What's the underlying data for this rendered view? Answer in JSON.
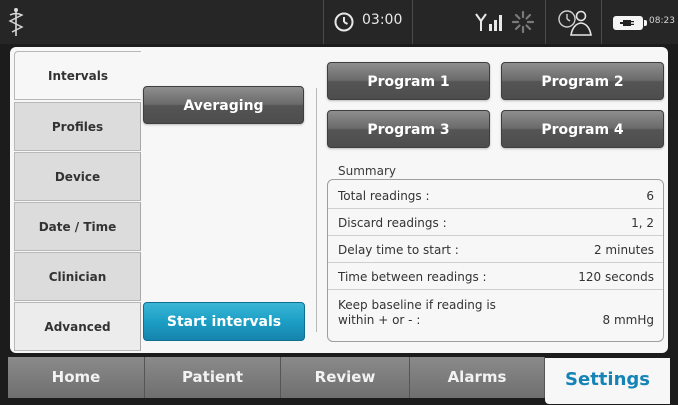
{
  "status_bar": {
    "logo_icon": "caduceus-icon",
    "clock_icon": "clock-icon",
    "time": "03:00",
    "signal_icon": "antenna-signal-icon",
    "activity_icon": "spinner-icon",
    "clinician_icon": "clinician-icon",
    "battery_icon": "battery-plug-icon",
    "battery_time": "08:23"
  },
  "sidebar": {
    "items": [
      {
        "label": "Intervals"
      },
      {
        "label": "Profiles"
      },
      {
        "label": "Device"
      },
      {
        "label": "Date / Time"
      },
      {
        "label": "Clinician"
      },
      {
        "label": "Advanced"
      }
    ],
    "active": "Intervals"
  },
  "intervals": {
    "averaging_label": "Averaging",
    "programs": [
      "Program 1",
      "Program 2",
      "Program 3",
      "Program 4"
    ],
    "start_label": "Start intervals"
  },
  "summary": {
    "title": "Summary",
    "rows": [
      {
        "label": "Total readings :",
        "value": "6"
      },
      {
        "label": "Discard readings :",
        "value": "1, 2"
      },
      {
        "label": "Delay time to start :",
        "value": "2 minutes"
      },
      {
        "label": "Time between readings :",
        "value": "120 seconds"
      },
      {
        "label": "Keep baseline if reading is within + or - :",
        "value": "8 mmHg"
      }
    ]
  },
  "nav": {
    "tabs": [
      {
        "label": "Home"
      },
      {
        "label": "Patient"
      },
      {
        "label": "Review"
      },
      {
        "label": "Alarms"
      },
      {
        "label": "Settings"
      }
    ],
    "active": "Settings"
  },
  "colors": {
    "accent_blue": "#1c9ec4",
    "active_tab_text": "#1683b6",
    "button_gray": "#6a6a6a"
  }
}
